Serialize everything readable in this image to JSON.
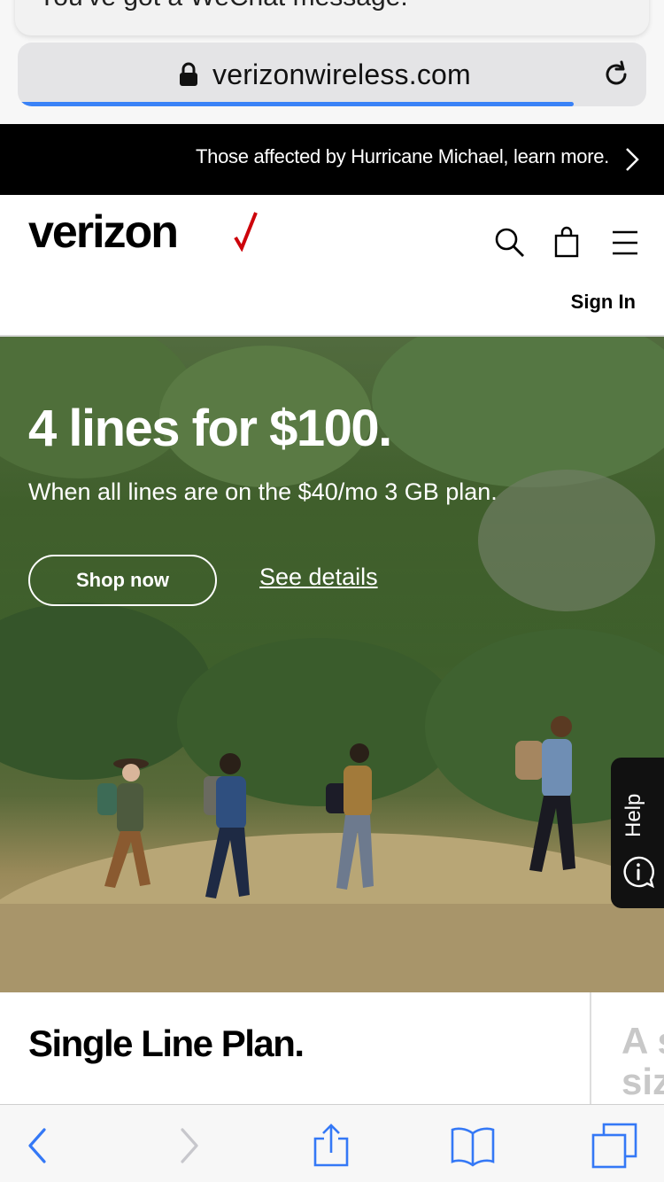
{
  "notification": {
    "text": "You've got a WeChat message."
  },
  "address_bar": {
    "url": "verizonwireless.com",
    "load_progress": 0.89
  },
  "alert_bar": {
    "text": "Those affected by Hurricane Michael, learn more."
  },
  "header": {
    "logo_text": "verizon",
    "brand_color": "#cd040b",
    "sign_in": "Sign In"
  },
  "hero": {
    "title": "4 lines for $100.",
    "subtitle": "When all lines are on the $40/mo 3 GB plan.",
    "shop_button": "Shop now",
    "details_link": "See details"
  },
  "help": {
    "label": "Help",
    "icon": "chat-help-icon"
  },
  "cards": [
    {
      "title": "Single Line Plan."
    },
    {
      "title": "A s siz"
    }
  ],
  "toolbar": {
    "icons": [
      "back-icon",
      "forward-icon",
      "share-icon",
      "bookmarks-icon",
      "tabs-icon"
    ],
    "accent": "#3478f6"
  }
}
